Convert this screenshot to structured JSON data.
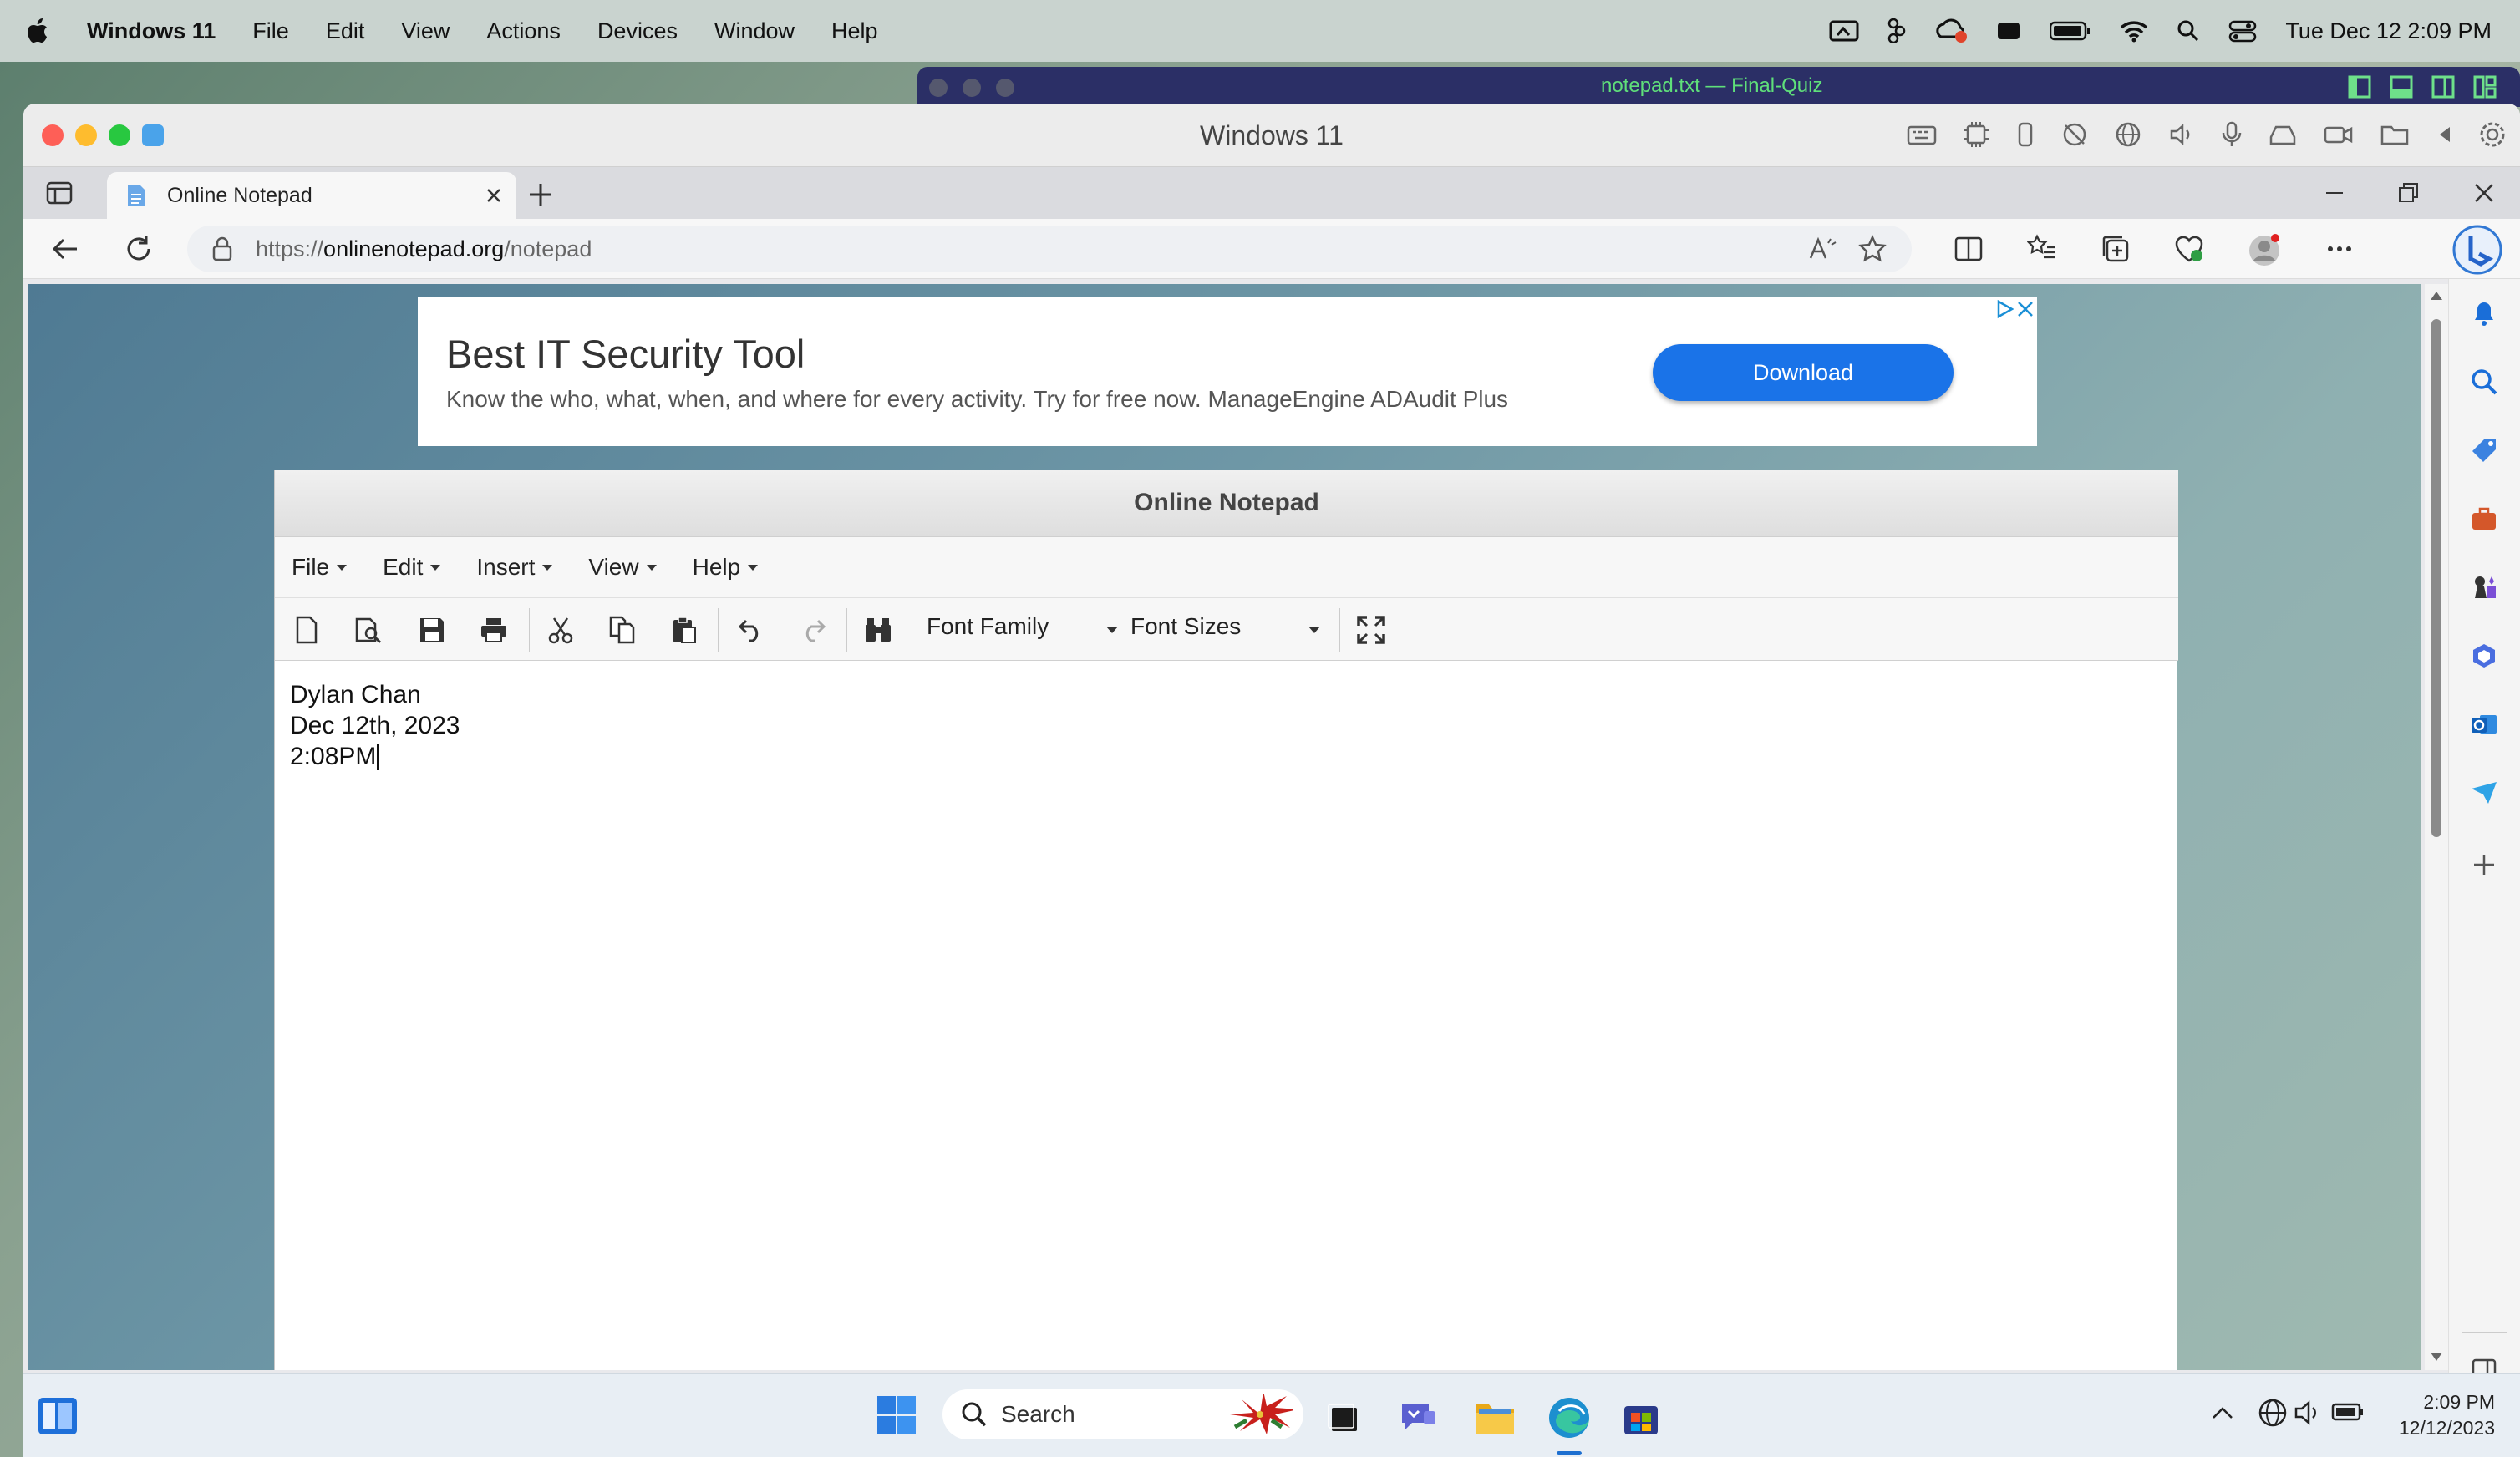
{
  "mac_menubar": {
    "app_name": "Windows 11",
    "menus": [
      "File",
      "Edit",
      "View",
      "Actions",
      "Devices",
      "Window",
      "Help"
    ],
    "datetime": "Tue Dec 12  2:09 PM"
  },
  "secondary_window": {
    "title": "notepad.txt — Final-Quiz"
  },
  "vm_window": {
    "title": "Windows 11"
  },
  "browser": {
    "tab_title": "Online Notepad",
    "url_prefix": "https://",
    "url_host": "onlinenotepad.org",
    "url_path": "/notepad"
  },
  "ad": {
    "headline": "Best IT Security Tool",
    "subtext": "Know the who, what, when, and where for every activity. Try for free now. ManageEngine ADAudit Plus",
    "button": "Download"
  },
  "notepad": {
    "title": "Online Notepad",
    "menus": [
      "File",
      "Edit",
      "Insert",
      "View",
      "Help"
    ],
    "font_family_label": "Font Family",
    "font_sizes_label": "Font Sizes",
    "lines": [
      "Dylan Chan",
      "Dec 12th, 2023",
      "2:08PM"
    ]
  },
  "taskbar": {
    "search_placeholder": "Search",
    "time": "2:09 PM",
    "date": "12/12/2023"
  },
  "colors": {
    "accent": "#1a73e8",
    "menubar": "#c9d3cf",
    "notebar": "#2b2f66"
  }
}
